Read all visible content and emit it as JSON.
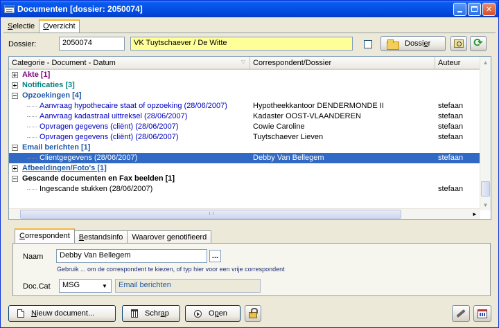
{
  "window": {
    "title": "Documenten  [dossier: 2050074]"
  },
  "main_tabs": [
    {
      "label": "Selectie",
      "accesskey": "S",
      "rest": "electie",
      "active": false
    },
    {
      "label": "Overzicht",
      "accesskey": "O",
      "rest": "verzicht",
      "active": true
    }
  ],
  "dossier": {
    "label": "Dossier:",
    "number": "2050074",
    "name": "VK Tuytschaever / De Witte",
    "button_label": "Dossier",
    "button_label_pre": "Dossi",
    "button_label_key": "e",
    "button_label_post": "r"
  },
  "grid": {
    "columns": [
      "Categorie - Document - Datum",
      "Correspondent/Dossier",
      "Auteur"
    ],
    "rows": [
      {
        "type": "category",
        "label": "Akte [1]",
        "expanded": false,
        "color": "#800080"
      },
      {
        "type": "category",
        "label": "Notificaties [3]",
        "expanded": false,
        "color": "#008080"
      },
      {
        "type": "category",
        "label": "Opzoekingen [4]",
        "expanded": true,
        "color": "#1e5aa8"
      },
      {
        "type": "item",
        "doc": "Aanvraag hypothecaire staat of opzoeking (28/06/2007)",
        "correspondent": "Hypotheekkantoor DENDERMONDE II",
        "author": "stefaan"
      },
      {
        "type": "item",
        "doc": "Aanvraag kadastraal uittreksel (28/06/2007)",
        "correspondent": "Kadaster OOST-VLAANDEREN",
        "author": "stefaan"
      },
      {
        "type": "item",
        "doc": "Opvragen gegevens (cliënt) (28/06/2007)",
        "correspondent": "Cowie Caroline",
        "author": "stefaan"
      },
      {
        "type": "item",
        "doc": "Opvragen gegevens (cliënt) (28/06/2007)",
        "correspondent": "Tuytschaever Lieven",
        "author": "stefaan"
      },
      {
        "type": "category",
        "label": "Email berichten [1]",
        "expanded": true,
        "color": "#1e5aa8"
      },
      {
        "type": "item",
        "doc": "Clientgegevens (28/06/2007)",
        "correspondent": "Debby Van Bellegem",
        "author": "stefaan",
        "selected": true
      },
      {
        "type": "category",
        "label": "Afbeeldingen/Foto's [1]",
        "expanded": false,
        "color": "#1e5aa8"
      },
      {
        "type": "category",
        "label": "Gescande documenten en Fax beelden [1]",
        "expanded": true,
        "color": "#000000"
      },
      {
        "type": "item",
        "doc": "Ingescande stukken (28/06/2007)",
        "correspondent": "",
        "author": "stefaan"
      }
    ]
  },
  "bottom_tabs": [
    {
      "label": "Correspondent",
      "key": "C",
      "rest": "orrespondent",
      "active": true
    },
    {
      "label": "Bestandsinfo",
      "key": "B",
      "rest": "estandsinfo",
      "active": false
    },
    {
      "label": "Waarover genotifieerd",
      "pre": "Waarover ",
      "key": "g",
      "rest": "enotifieerd",
      "active": false
    }
  ],
  "correspondent": {
    "naam_label": "Naam",
    "naam_value": "Debby Van Bellegem",
    "ellipsis": "...",
    "hint": "Gebruik ... om de correspondent te kiezen, of typ hier voor een vrije correspondent",
    "doccat_label": "Doc.Cat",
    "doccat_value": "MSG",
    "doccat_desc": "Email berichten"
  },
  "footer": {
    "new_doc": {
      "pre": "",
      "key": "N",
      "rest": "ieuw document..."
    },
    "delete": {
      "pre": "Schr",
      "key": "a",
      "rest": "p"
    },
    "open": {
      "pre": "O",
      "key": "p",
      "rest": "en"
    }
  }
}
